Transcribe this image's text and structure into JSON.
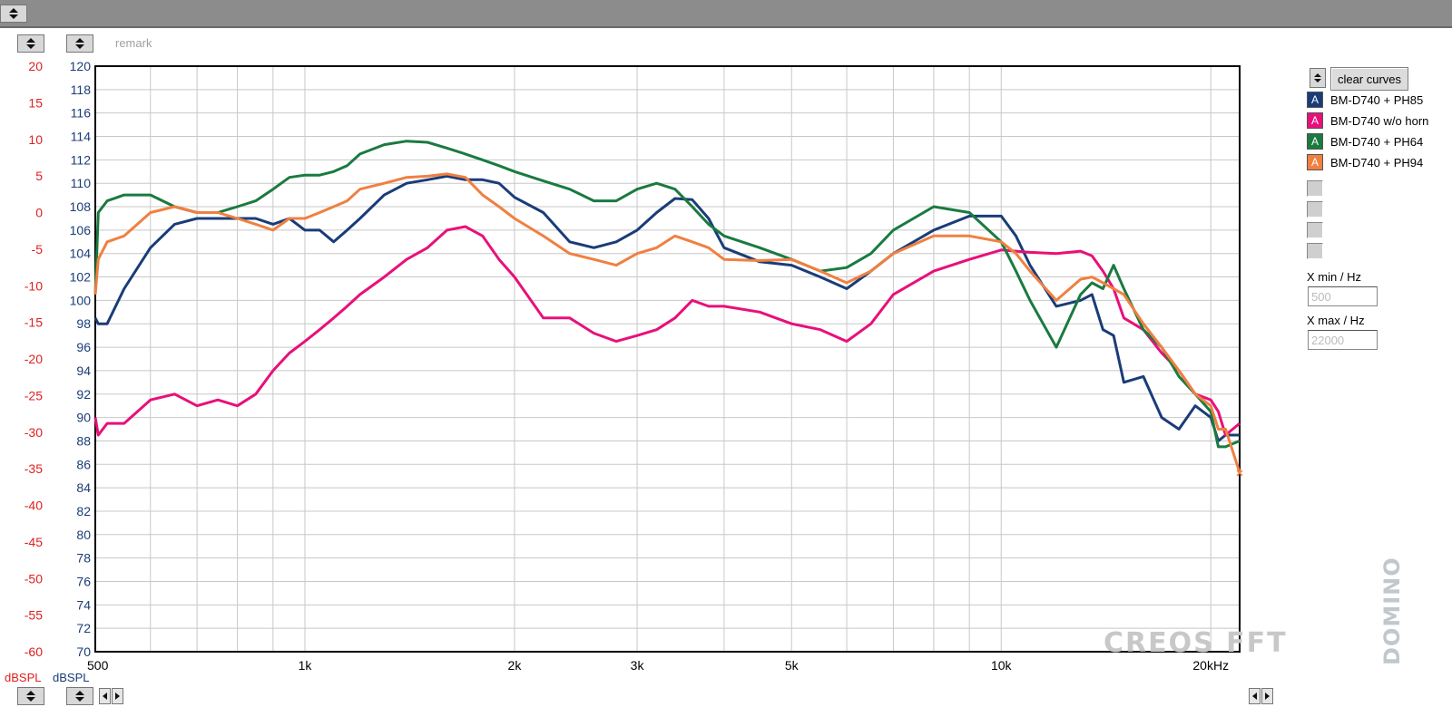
{
  "remark": "remark",
  "units": {
    "left": "dBSPL",
    "right": "dBSPL"
  },
  "clear_label": "clear curves",
  "xmin_label": "X min / Hz",
  "xmin_value": "500",
  "xmax_label": "X max / Hz",
  "xmax_value": "22000",
  "watermark": "CREOS FFT",
  "logo_text": "DOMINO",
  "colors": {
    "left_axis": "#e02020",
    "right_axis": "#1a3c78"
  },
  "chart_data": {
    "type": "line",
    "x_scale": "log",
    "xlim": [
      500,
      22000
    ],
    "ylim": [
      70,
      120
    ],
    "y2lim": [
      -60,
      20
    ],
    "x_ticks": [
      500,
      1000,
      2000,
      3000,
      5000,
      10000,
      20000
    ],
    "x_tick_labels": [
      "500",
      "1k",
      "2k",
      "3k",
      "5k",
      "10k",
      "20kHz"
    ],
    "y_ticks": [
      70,
      72,
      74,
      76,
      78,
      80,
      82,
      84,
      86,
      88,
      90,
      92,
      94,
      96,
      98,
      100,
      102,
      104,
      106,
      108,
      110,
      112,
      114,
      116,
      118,
      120
    ],
    "y2_ticks": [
      -60,
      -55,
      -50,
      -45,
      -40,
      -35,
      -30,
      -25,
      -20,
      -15,
      -10,
      -5,
      0,
      5,
      10,
      15,
      20
    ],
    "grid": true,
    "series": [
      {
        "name": "BM-D740 + PH85",
        "color": "#1a3c78",
        "x": [
          500,
          505,
          520,
          550,
          600,
          650,
          700,
          750,
          800,
          850,
          900,
          950,
          1000,
          1050,
          1100,
          1150,
          1200,
          1300,
          1400,
          1500,
          1600,
          1700,
          1800,
          1900,
          2000,
          2200,
          2400,
          2600,
          2800,
          3000,
          3200,
          3400,
          3600,
          3800,
          4000,
          4500,
          5000,
          5500,
          6000,
          6500,
          7000,
          8000,
          9000,
          10000,
          10500,
          11000,
          12000,
          13000,
          13500,
          14000,
          14500,
          15000,
          16000,
          17000,
          18000,
          19000,
          20000,
          20500,
          21000,
          22000
        ],
        "y": [
          98.5,
          98,
          98,
          101,
          104.5,
          106.5,
          107,
          107,
          107,
          107,
          106.5,
          107,
          106,
          106,
          105,
          106,
          107,
          109,
          110,
          110.3,
          110.6,
          110.3,
          110.3,
          110,
          108.8,
          107.5,
          105,
          104.5,
          105,
          106,
          107.5,
          108.7,
          108.6,
          107,
          104.5,
          103.3,
          103,
          102,
          101,
          102.5,
          104,
          106,
          107.2,
          107.2,
          105.5,
          103,
          99.5,
          100,
          100.5,
          97.5,
          97,
          93,
          93.5,
          90,
          89,
          91,
          90,
          88,
          88.5,
          88.5
        ]
      },
      {
        "name": "BM-D740  w/o horn",
        "color": "#e8107a",
        "x": [
          500,
          505,
          520,
          550,
          600,
          650,
          700,
          750,
          800,
          850,
          900,
          950,
          1000,
          1050,
          1100,
          1150,
          1200,
          1300,
          1400,
          1500,
          1600,
          1700,
          1800,
          1900,
          2000,
          2200,
          2400,
          2600,
          2800,
          3000,
          3200,
          3400,
          3600,
          3800,
          4000,
          4500,
          5000,
          5500,
          6000,
          6500,
          7000,
          8000,
          9000,
          10000,
          10500,
          11000,
          12000,
          13000,
          13500,
          14000,
          14500,
          15000,
          16000,
          17000,
          18000,
          19000,
          20000,
          20500,
          21000,
          22000
        ],
        "y": [
          90,
          88.5,
          89.5,
          89.5,
          91.5,
          92,
          91,
          91.5,
          91,
          92,
          94,
          95.5,
          96.5,
          97.5,
          98.5,
          99.5,
          100.5,
          102,
          103.5,
          104.5,
          106,
          106.3,
          105.5,
          103.5,
          102,
          98.5,
          98.5,
          97.2,
          96.5,
          97,
          97.5,
          98.5,
          100,
          99.5,
          99.5,
          99,
          98,
          97.5,
          96.5,
          98,
          100.5,
          102.5,
          103.5,
          104.3,
          104.2,
          104.1,
          104,
          104.2,
          103.8,
          102.5,
          101,
          98.5,
          97.5,
          95.5,
          94,
          92,
          91.5,
          90.5,
          88.5,
          89.5
        ]
      },
      {
        "name": "BM-D740 + PH64",
        "color": "#1a7a40",
        "x": [
          500,
          505,
          520,
          550,
          600,
          650,
          700,
          750,
          800,
          850,
          900,
          950,
          1000,
          1050,
          1100,
          1150,
          1200,
          1300,
          1400,
          1500,
          1600,
          1700,
          1800,
          1900,
          2000,
          2200,
          2400,
          2600,
          2800,
          3000,
          3200,
          3400,
          3600,
          3800,
          4000,
          4500,
          5000,
          5500,
          6000,
          6500,
          7000,
          8000,
          9000,
          10000,
          10500,
          11000,
          12000,
          13000,
          13500,
          14000,
          14500,
          15000,
          16000,
          17000,
          18000,
          19000,
          20000,
          20500,
          21000,
          22000
        ],
        "y": [
          100.5,
          107.5,
          108.5,
          109,
          109,
          108,
          107.5,
          107.5,
          108,
          108.5,
          109.5,
          110.5,
          110.7,
          110.7,
          111,
          111.5,
          112.5,
          113.3,
          113.6,
          113.5,
          113,
          112.5,
          112,
          111.5,
          111,
          110.2,
          109.5,
          108.5,
          108.5,
          109.5,
          110,
          109.5,
          108,
          106.5,
          105.5,
          104.5,
          103.5,
          102.5,
          102.8,
          104,
          106,
          108,
          107.5,
          105,
          102.5,
          100,
          96,
          100.5,
          101.5,
          101,
          103,
          101,
          97.5,
          96,
          93.5,
          92,
          90.5,
          87.5,
          87.5,
          88
        ]
      },
      {
        "name": "BM-D740 + PH94",
        "color": "#f08040",
        "x": [
          500,
          505,
          520,
          550,
          600,
          650,
          700,
          750,
          800,
          850,
          900,
          950,
          1000,
          1050,
          1100,
          1150,
          1200,
          1300,
          1400,
          1500,
          1600,
          1700,
          1800,
          1900,
          2000,
          2200,
          2400,
          2600,
          2800,
          3000,
          3200,
          3400,
          3600,
          3800,
          4000,
          4500,
          5000,
          5500,
          6000,
          6500,
          7000,
          8000,
          9000,
          10000,
          10500,
          11000,
          12000,
          13000,
          13500,
          14000,
          14500,
          15000,
          16000,
          17000,
          18000,
          19000,
          20000,
          20500,
          21000,
          22000
        ],
        "y": [
          100.5,
          103.5,
          105,
          105.5,
          107.5,
          108,
          107.5,
          107.5,
          107,
          106.5,
          106,
          107,
          107,
          107.5,
          108,
          108.5,
          109.5,
          110,
          110.5,
          110.6,
          110.8,
          110.5,
          109,
          108,
          107,
          105.5,
          104,
          103.5,
          103,
          104,
          104.5,
          105.5,
          105,
          104.5,
          103.5,
          103.4,
          103.5,
          102.5,
          101.5,
          102.5,
          104,
          105.5,
          105.5,
          105,
          104,
          102.5,
          100,
          101.8,
          102,
          101.5,
          101,
          100.5,
          98,
          96,
          94,
          92,
          91,
          89,
          89,
          85.3
        ]
      }
    ]
  }
}
